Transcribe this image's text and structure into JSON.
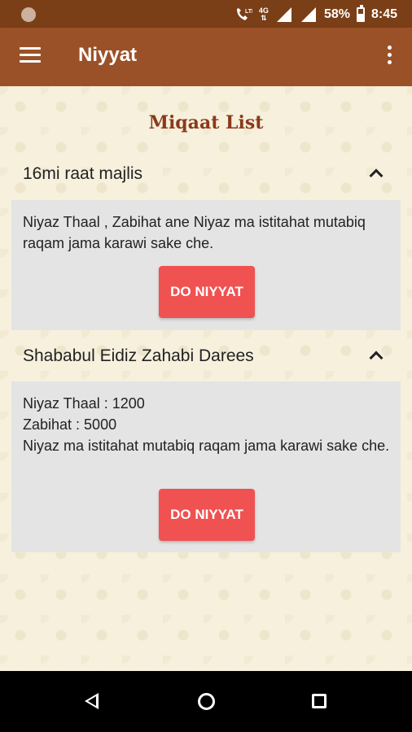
{
  "status_bar": {
    "network": "4G",
    "battery": "58%",
    "time": "8:45",
    "icons": [
      "notification-dot-icon",
      "volte-icon",
      "signal-icon",
      "signal-icon",
      "battery-icon"
    ]
  },
  "app_bar": {
    "title": "Niyyat",
    "icons": [
      "menu-icon",
      "overflow-menu-icon"
    ],
    "color": "#9b5127"
  },
  "page": {
    "heading": "Miqaat List"
  },
  "miqaats": [
    {
      "title": "16mi raat majlis",
      "description": "Niyaz Thaal , Zabihat ane  Niyaz ma istitahat mutabiq raqam jama karawi sake che.",
      "button_label": "DO NIYYAT",
      "expanded": true
    },
    {
      "title": "Shababul Eidiz Zahabi Darees",
      "description": "Niyaz Thaal : 1200\nZabihat : 5000\nNiyaz ma istitahat mutabiq raqam jama karawi sake che.",
      "button_label": "DO NIYYAT",
      "expanded": true
    }
  ],
  "colors": {
    "status_bar": "#7a3f17",
    "heading": "#8b3a1a",
    "button": "#f05151",
    "card": "#e4e4e4"
  },
  "nav_bar": {
    "icons": [
      "back-icon",
      "home-icon",
      "recents-icon"
    ]
  }
}
